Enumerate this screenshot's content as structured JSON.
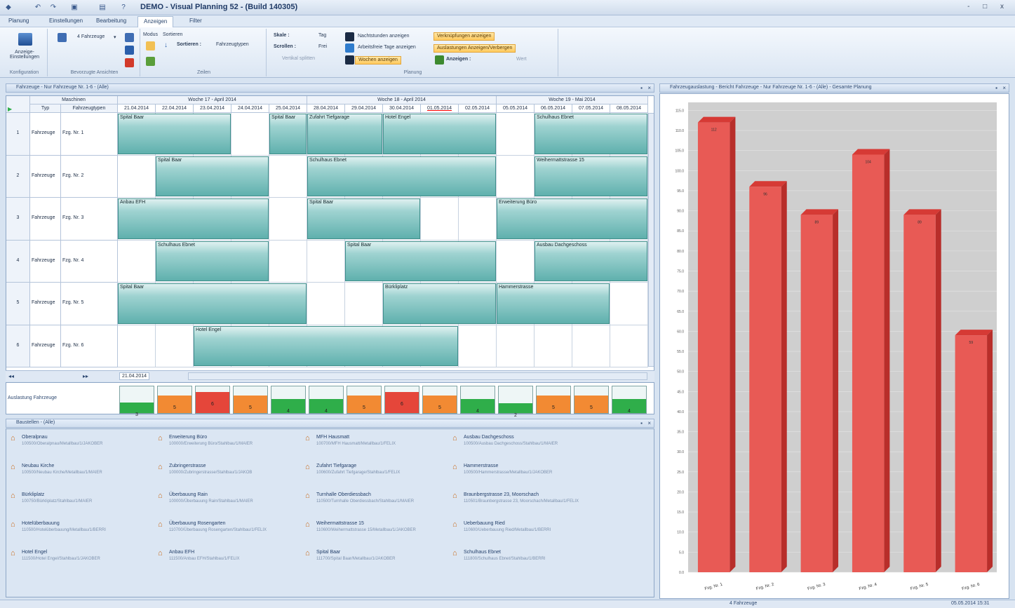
{
  "app": {
    "title": "DEMO - Visual Planning 52 - (Build 140305)",
    "window_controls": "- □ x"
  },
  "menu": {
    "items": [
      "Planung",
      "Einstellungen",
      "Bearbeitung",
      "Anzeigen",
      "Filter"
    ],
    "active": "Anzeigen"
  },
  "ribbon": {
    "konfig": {
      "label": "Anzeige-Einstellungen",
      "group": "Konfiguration"
    },
    "fav": {
      "value": "4 Fahrzeuge",
      "group": "Bevorzugte Ansichten"
    },
    "zeilen": {
      "modus": "Modus",
      "sortieren": "Sortieren",
      "sortieren_label": "Sortieren :",
      "sortieren_value": "Fahrzeugtypen",
      "group": "Zeilen"
    },
    "planung": {
      "skale": "Skale :",
      "skale_val": "Tag",
      "scrollen": "Scrollen :",
      "scrollen_val": "Frei",
      "vertikal": "Vertikal splitten",
      "nacht": "Nachtstunden anzeigen",
      "arbeitsfrei": "Arbeitsfreie Tage anzeigen",
      "wochen": "Wochen anzeigen",
      "verknuepfungen": "Verknüpfungen anzeigen",
      "auslastungen": "Auslastungen Anzeigen/Verbergen",
      "anzeigen": "Anzeigen :",
      "anzeigen_val": "Wert",
      "group": "Planung"
    }
  },
  "planpane": {
    "title": "Fahrzeuge - Nur Fahrzeuge Nr. 1-6 - (Alle)"
  },
  "grid": {
    "col_group": "Maschinen",
    "col_typ": "Typ",
    "col_fzt": "Fahrzeugtypen",
    "weeks": [
      "Woche 17 - April 2014",
      "Woche 18 - April 2014",
      "Woche 19 - Mai 2014"
    ],
    "days": [
      "21.04.2014",
      "22.04.2014",
      "23.04.2014",
      "24.04.2014",
      "25.04.2014",
      "28.04.2014",
      "29.04.2014",
      "30.04.2014",
      "01.05.2014",
      "02.05.2014",
      "05.05.2014",
      "06.05.2014",
      "07.05.2014",
      "08.05.2014"
    ],
    "rows": [
      {
        "n": "1",
        "typ": "Fahrzeuge",
        "name": "Fzg. Nr. 1"
      },
      {
        "n": "2",
        "typ": "Fahrzeuge",
        "name": "Fzg. Nr. 2"
      },
      {
        "n": "3",
        "typ": "Fahrzeuge",
        "name": "Fzg. Nr. 3"
      },
      {
        "n": "4",
        "typ": "Fahrzeuge",
        "name": "Fzg. Nr. 4"
      },
      {
        "n": "5",
        "typ": "Fahrzeuge",
        "name": "Fzg. Nr. 5"
      },
      {
        "n": "6",
        "typ": "Fahrzeuge",
        "name": "Fzg. Nr. 6"
      }
    ],
    "tasks": [
      {
        "row": 0,
        "start": 0,
        "len": 3,
        "label": "Spital Baar"
      },
      {
        "row": 0,
        "start": 4,
        "len": 1,
        "label": "Spital Baar"
      },
      {
        "row": 0,
        "start": 5,
        "len": 2,
        "label": "Zufahrt Tiefgarage"
      },
      {
        "row": 0,
        "start": 7,
        "len": 3,
        "label": "Hotel Engel"
      },
      {
        "row": 0,
        "start": 11,
        "len": 3,
        "label": "Schulhaus Ebnet"
      },
      {
        "row": 1,
        "start": 1,
        "len": 3,
        "label": "Spital Baar"
      },
      {
        "row": 1,
        "start": 5,
        "len": 5,
        "label": "Schulhaus Ebnet"
      },
      {
        "row": 1,
        "start": 11,
        "len": 3,
        "label": "Weihermattstrasse 15"
      },
      {
        "row": 2,
        "start": 0,
        "len": 4,
        "label": "Anbau EFH"
      },
      {
        "row": 2,
        "start": 5,
        "len": 3,
        "label": "Spital Baar"
      },
      {
        "row": 2,
        "start": 10,
        "len": 4,
        "label": "Erweiterung Büro"
      },
      {
        "row": 3,
        "start": 1,
        "len": 3,
        "label": "Schulhaus Ebnet"
      },
      {
        "row": 3,
        "start": 6,
        "len": 4,
        "label": "Spital Baar"
      },
      {
        "row": 3,
        "start": 11,
        "len": 3,
        "label": "Ausbau Dachgeschoss"
      },
      {
        "row": 4,
        "start": 0,
        "len": 5,
        "label": "Spital Baar"
      },
      {
        "row": 4,
        "start": 7,
        "len": 3,
        "label": "Bürkliplatz"
      },
      {
        "row": 4,
        "start": 10,
        "len": 3,
        "label": "Hammerstrasse"
      },
      {
        "row": 5,
        "start": 2,
        "len": 7,
        "label": "Hotel Engel"
      }
    ],
    "nav_date": "21.04.2014"
  },
  "utilization": {
    "label": "Auslastung Fahrzeuge",
    "values": [
      3,
      5,
      6,
      5,
      4,
      4,
      5,
      6,
      5,
      4,
      2,
      5,
      5,
      4
    ],
    "colors": [
      "#2fae4a",
      "#f28a33",
      "#e5463a",
      "#f28a33",
      "#2fae4a",
      "#2fae4a",
      "#f28a33",
      "#e5463a",
      "#f28a33",
      "#2fae4a",
      "#2fae4a",
      "#f28a33",
      "#f28a33",
      "#2fae4a"
    ]
  },
  "sitespane": {
    "title": "Baustellen - (Alle)",
    "items": [
      {
        "name": "Oberalpnau",
        "desc": "100500/Oberalpnau/Metallbau/1/JAKOBER"
      },
      {
        "name": "Neubau Kirche",
        "desc": "100500/Neubau Kirche/Metallbau/1/MAIER"
      },
      {
        "name": "Bürkliplatz",
        "desc": "100750/Bürkliplatz/Stahlbau/1/MAIER"
      },
      {
        "name": "Hotelüberbauung",
        "desc": "110500/Hotelüberbauung/Metallbau/1/BERRI"
      },
      {
        "name": "Hotel Engel",
        "desc": "111500/Hotel Engel/Stahlbau/1/JAKOBER"
      },
      {
        "name": "Erweiterung Büro",
        "desc": "100000/Erweiterung Büro/Stahlbau/1/MAIER"
      },
      {
        "name": "Zubringerstrasse",
        "desc": "100000/Zubringerstrasse/Stahlbau/1/JAKOB"
      },
      {
        "name": "Überbauung Rain",
        "desc": "100000/Überbauung Rain/Stahlbau/1/MAIER"
      },
      {
        "name": "Überbauung Rosengarten",
        "desc": "110700/Überbauung Rosengarten/Stahlbau/1/FELIX"
      },
      {
        "name": "Anbau EFH",
        "desc": "111500/Anbau EFH/Stahlbau/1/FELIX"
      },
      {
        "name": "MFH Hausmatt",
        "desc": "100700/MFH Hausmatt/Metallbau/1/FELIX"
      },
      {
        "name": "Zufahrt Tiefgarage",
        "desc": "100600/Zufahrt Tiefgarage/Stahlbau/1/FELIX"
      },
      {
        "name": "Turnhalle Oberdiessbach",
        "desc": "110500/Turnhalle Oberdiessbach/Stahlbau/1/MAIER"
      },
      {
        "name": "Weihermattstrasse 15",
        "desc": "110600/Weihermattstrasse 15/Metallbau/1/JAKOBER"
      },
      {
        "name": "Spital Baar",
        "desc": "111700/Spital Baar/Metallbau/1/JAKOBER"
      },
      {
        "name": "Ausbau Dachgeschoss",
        "desc": "100500/Ausbau Dachgeschoss/Stahlbau/1/MAIER"
      },
      {
        "name": "Hammerstrasse",
        "desc": "100500/Hammerstrasse/Metallbau/1/JAKOBER"
      },
      {
        "name": "Braunbergstrasse 23, Moorschach",
        "desc": "110501/Braunbergstrasse 23, Moorschach/Metallbau/1/FELIX"
      },
      {
        "name": "Ueberbauung Ried",
        "desc": "110600/Ueberbauung Ried/Metallbau/1/BERRI"
      },
      {
        "name": "Schulhaus Ebnet",
        "desc": "111800/Schulhaus Ebnet/Stahlbau/1/BERRI"
      }
    ]
  },
  "chartpane": {
    "title": "Fahrzeugauslastung - Bericht Fahrzeuge - Nur Fahrzeuge Nr. 1-6 - (Alle) - Gesamte Planung"
  },
  "chart_data": {
    "type": "bar",
    "categories": [
      "Fzg. Nr. 1",
      "Fzg. Nr. 2",
      "Fzg. Nr. 3",
      "Fzg. Nr. 4",
      "Fzg. Nr. 5",
      "Fzg. Nr. 6"
    ],
    "values": [
      112,
      96,
      89,
      104,
      89,
      59
    ],
    "ylim": [
      0,
      117
    ],
    "color": "#e85a55",
    "grid": true
  },
  "status": {
    "left": "4 Fahrzeuge",
    "right": "05.05.2014 15:31"
  }
}
